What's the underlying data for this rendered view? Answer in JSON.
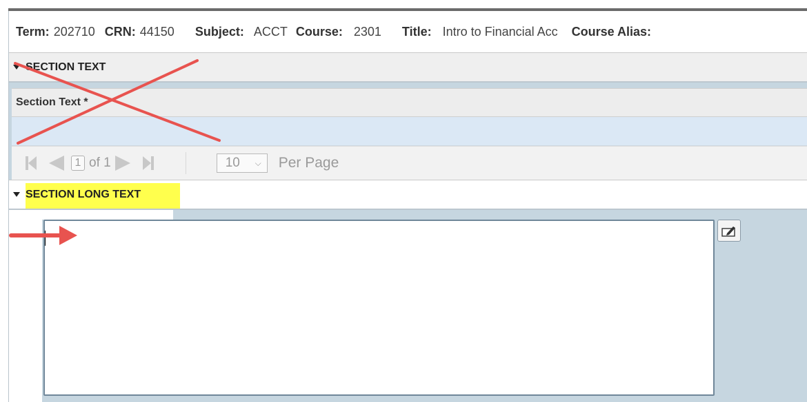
{
  "key_block": {
    "term_label": "Term:",
    "term_value": "202710",
    "crn_label": "CRN:",
    "crn_value": "44150",
    "subject_label": "Subject:",
    "subject_value": "ACCT",
    "course_label": "Course:",
    "course_value": "2301",
    "title_label": "Title:",
    "title_value": "Intro to Financial Acc",
    "alias_label": "Course Alias:"
  },
  "section_text": {
    "header": "SECTION TEXT",
    "column_header": "Section Text *"
  },
  "pager": {
    "page_value": "1",
    "of_text": "of 1",
    "per_page_value": "10",
    "per_page_label": "Per Page"
  },
  "section_long_text": {
    "header": "SECTION LONG TEXT",
    "textarea_value": ""
  },
  "icons": {
    "caret": "caret-down-icon",
    "first": "first-page-icon",
    "prev": "prev-page-icon",
    "next": "next-page-icon",
    "last": "last-page-icon",
    "edit": "edit-icon",
    "select_chevron": "chevron-down-icon"
  },
  "colors": {
    "annotation_red": "#e8534f",
    "highlight_yellow": "#ffff2e",
    "panel_blue": "#c6d6e0",
    "row_blue": "#dbe8f5"
  }
}
